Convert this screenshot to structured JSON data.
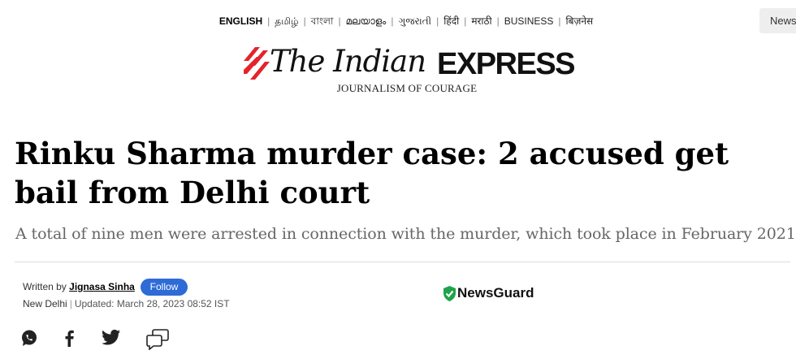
{
  "languages": [
    {
      "label": "ENGLISH",
      "active": true
    },
    {
      "label": "தமிழ்"
    },
    {
      "label": "বাংলা"
    },
    {
      "label": "മലയാളം"
    },
    {
      "label": "ગુજરાતી"
    },
    {
      "label": "हिंदी"
    },
    {
      "label": "मराठी"
    },
    {
      "label": "BUSINESS"
    },
    {
      "label": "बिज़नेस"
    }
  ],
  "top_right_button": "News",
  "logo": {
    "the_indian": "The Indian",
    "express": "EXPRESS",
    "tagline": "JOURNALISM OF COURAGE",
    "brand_color": "#e4232a"
  },
  "article": {
    "headline": "Rinku Sharma murder case: 2 accused get bail from Delhi court",
    "subhead": "A total of nine men were arrested in connection with the murder, which took place in February 2021",
    "byline_prefix": "Written by",
    "author": "Jignasa Sinha",
    "follow_label": "Follow",
    "location": "New Delhi",
    "separator": "|",
    "updated": "Updated: March 28, 2023 08:52 IST"
  },
  "newsguard": {
    "label": "NewsGuard",
    "shield_color": "#1fa34a"
  },
  "share_icons": [
    "whatsapp-icon",
    "facebook-icon",
    "twitter-icon",
    "comment-icon"
  ],
  "colors": {
    "follow_button": "#2e6bd6",
    "subhead": "#666666"
  }
}
